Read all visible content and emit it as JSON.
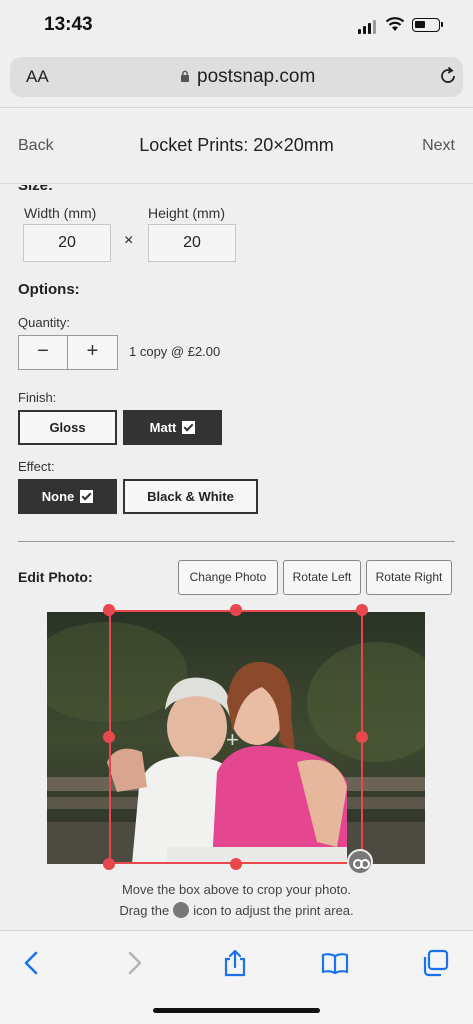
{
  "status": {
    "time": "13:43"
  },
  "browser": {
    "text_size_label": "AA",
    "host": "postsnap.com"
  },
  "header": {
    "back_label": "Back",
    "title": "Locket Prints: 20×20mm",
    "next_label": "Next"
  },
  "size": {
    "section_label": "Size:",
    "width_label": "Width (mm)",
    "width_value": "20",
    "times_sign": "×",
    "height_label": "Height (mm)",
    "height_value": "20"
  },
  "options": {
    "heading": "Options:",
    "quantity_label": "Quantity:",
    "minus": "−",
    "plus": "+",
    "quantity_summary": "1 copy @ £2.00",
    "finish_label": "Finish:",
    "finish_gloss": "Gloss",
    "finish_matt": "Matt",
    "finish_selected": "Matt",
    "effect_label": "Effect:",
    "effect_none": "None",
    "effect_bw": "Black & White",
    "effect_selected": "None"
  },
  "edit": {
    "label": "Edit Photo:",
    "change_photo": "Change Photo",
    "rotate_left": "Rotate Left",
    "rotate_right": "Rotate Right",
    "hint_line1": "Move the box above to crop your photo.",
    "hint_line2_pre": "Drag the",
    "hint_line2_post": "icon to adjust the print area."
  },
  "colors": {
    "crop_accent": "#e8474e",
    "selected_button": "#333333",
    "safari_blue": "#1a73e8"
  },
  "toolbar_icons": [
    "back-icon",
    "forward-icon",
    "share-icon",
    "bookmarks-icon",
    "tabs-icon"
  ]
}
